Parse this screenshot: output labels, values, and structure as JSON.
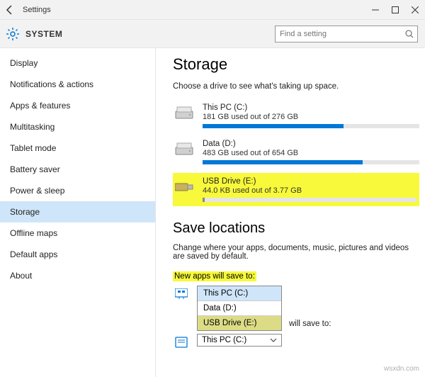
{
  "window": {
    "app_title": "Settings",
    "section": "SYSTEM"
  },
  "search": {
    "placeholder": "Find a setting"
  },
  "sidebar": {
    "items": [
      {
        "label": "Display"
      },
      {
        "label": "Notifications & actions"
      },
      {
        "label": "Apps & features"
      },
      {
        "label": "Multitasking"
      },
      {
        "label": "Tablet mode"
      },
      {
        "label": "Battery saver"
      },
      {
        "label": "Power & sleep"
      },
      {
        "label": "Storage"
      },
      {
        "label": "Offline maps"
      },
      {
        "label": "Default apps"
      },
      {
        "label": "About"
      }
    ],
    "selected_index": 7
  },
  "storage": {
    "heading": "Storage",
    "description": "Choose a drive to see what's taking up space.",
    "drives": [
      {
        "name": "This PC (C:)",
        "subtitle": "181 GB used out of 276 GB",
        "used_pct": 65,
        "type": "hdd",
        "highlight": false
      },
      {
        "name": "Data (D:)",
        "subtitle": "483 GB used out of 654 GB",
        "used_pct": 74,
        "type": "hdd",
        "highlight": false
      },
      {
        "name": "USB Drive (E:)",
        "subtitle": "44.0 KB used out of 3.77 GB",
        "used_pct": 1,
        "type": "usb",
        "highlight": true
      }
    ]
  },
  "save_locations": {
    "heading": "Save locations",
    "description": "Change where your apps, documents, music, pictures and videos are saved by default.",
    "new_apps_label": "New apps will save to:",
    "dropdown_options": [
      {
        "label": "This PC (C:)",
        "state": "selected"
      },
      {
        "label": "Data (D:)",
        "state": ""
      },
      {
        "label": "USB Drive (E:)",
        "state": "hover"
      }
    ],
    "partial_label": " will save to:",
    "collapsed_value": "This PC (C:)"
  },
  "watermark": "wsxdn.com"
}
